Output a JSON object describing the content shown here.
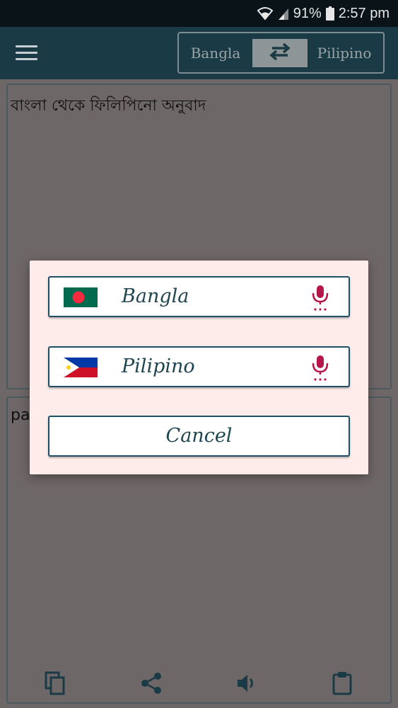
{
  "status_bar": {
    "battery": "91%",
    "time": "2:57 pm",
    "icons": [
      "wifi-icon",
      "signal-icon",
      "battery-icon"
    ]
  },
  "app_bar": {
    "menu_icon": "hamburger-menu-icon",
    "source_language": "Bangla",
    "target_language": "Pilipino",
    "swap_icon": "swap-arrows-icon"
  },
  "input_panel": {
    "text": "বাংলা থেকে ফিলিপিনো অনুবাদ"
  },
  "output_panel": {
    "text": "pa"
  },
  "toolbar": {
    "icons": [
      "copy-icon",
      "share-icon",
      "speaker-icon",
      "clipboard-icon"
    ]
  },
  "dialog": {
    "options": [
      {
        "label": "Bangla",
        "flag": "bangladesh-flag-icon",
        "mic": "microphone-icon"
      },
      {
        "label": "Pilipino",
        "flag": "philippines-flag-icon",
        "mic": "microphone-icon"
      }
    ],
    "cancel_label": "Cancel"
  },
  "colors": {
    "app_bar": "#1a3b45",
    "status_bar": "#0a1418",
    "dialog_bg": "#fdecea",
    "button_border": "#1e4f64",
    "mic": "#b5174a",
    "scrim": "#6e6767"
  }
}
